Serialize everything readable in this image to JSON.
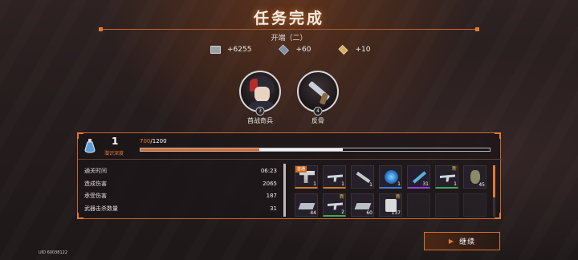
{
  "header": {
    "title": "任务完成",
    "stage": "开端（二）"
  },
  "rewards": [
    {
      "icon": "cash-icon",
      "value": "+6255"
    },
    {
      "icon": "cube-icon",
      "value": "+60"
    },
    {
      "icon": "gem-icon",
      "value": "+10"
    }
  ],
  "characters": [
    {
      "name": "首战奇兵",
      "level": "3",
      "icon": "character-portrait-icon"
    },
    {
      "name": "反骨",
      "level": "4",
      "icon": "weapon-portrait-icon"
    }
  ],
  "exploration": {
    "level": "1",
    "label": "潜识深度",
    "exp_current": "700",
    "exp_sep": "/",
    "exp_max": "1200",
    "progress_before": 0.34,
    "progress_after": 0.58
  },
  "stats": [
    {
      "label": "通关时间",
      "value": "06:23"
    },
    {
      "label": "造成伤害",
      "value": "2065"
    },
    {
      "label": "承受伤害",
      "value": "187"
    },
    {
      "label": "武器击杀数量",
      "value": "31"
    }
  ],
  "items": [
    {
      "icon": "pistol-icon",
      "qty": "1",
      "tag": "首通",
      "new": ""
    },
    {
      "icon": "rifle-icon",
      "qty": "1",
      "tag": "",
      "new": ""
    },
    {
      "icon": "weapon-frame-icon",
      "qty": "1",
      "tag": "",
      "new": ""
    },
    {
      "icon": "orb-icon",
      "qty": "1",
      "tag": "",
      "new": ""
    },
    {
      "icon": "blade-icon",
      "qty": "31",
      "tag": "",
      "new": ""
    },
    {
      "icon": "smg-icon",
      "qty": "1",
      "tag": "",
      "new": "新"
    },
    {
      "icon": "grenade-icon",
      "qty": "45",
      "tag": "",
      "new": ""
    },
    {
      "icon": "plate-icon",
      "qty": "44",
      "tag": "",
      "new": ""
    },
    {
      "icon": "rifle-icon",
      "qty": "2",
      "tag": "",
      "new": "新"
    },
    {
      "icon": "plate-icon",
      "qty": "60",
      "tag": "",
      "new": ""
    },
    {
      "icon": "pack-icon",
      "qty": "137",
      "tag": "",
      "new": "新"
    }
  ],
  "actions": {
    "continue_label": "继续"
  },
  "footer": {
    "uid": "UID 60038122"
  }
}
